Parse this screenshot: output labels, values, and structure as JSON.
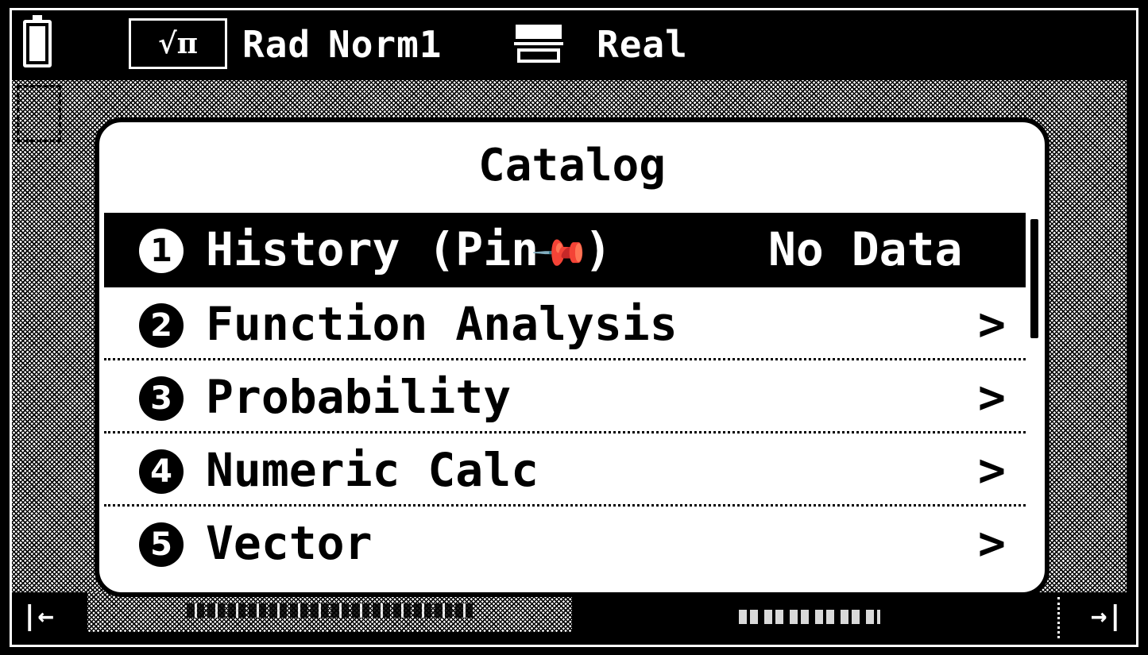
{
  "status_bar": {
    "mode_symbol": "√π",
    "angle_unit": "Rad",
    "number_format": "Norm1",
    "complex_mode": "Real",
    "icons": [
      "battery-icon",
      "display-mode-icon"
    ]
  },
  "dialog": {
    "title": "Catalog",
    "items": [
      {
        "number": "1",
        "label": "History (Pin",
        "pin_icon": "📌",
        "label_end": ")",
        "value": "No Data",
        "selected": true
      },
      {
        "number": "2",
        "label": "Function Analysis",
        "arrow": ">"
      },
      {
        "number": "3",
        "label": "Probability",
        "arrow": ">"
      },
      {
        "number": "4",
        "label": "Numeric Calc",
        "arrow": ">"
      },
      {
        "number": "5",
        "label": "Vector",
        "arrow": ">"
      }
    ]
  },
  "bottom_bar": {
    "left_nav": "|←",
    "right_nav": "→|"
  },
  "colors": {
    "background": "#000000",
    "foreground": "#ffffff"
  }
}
